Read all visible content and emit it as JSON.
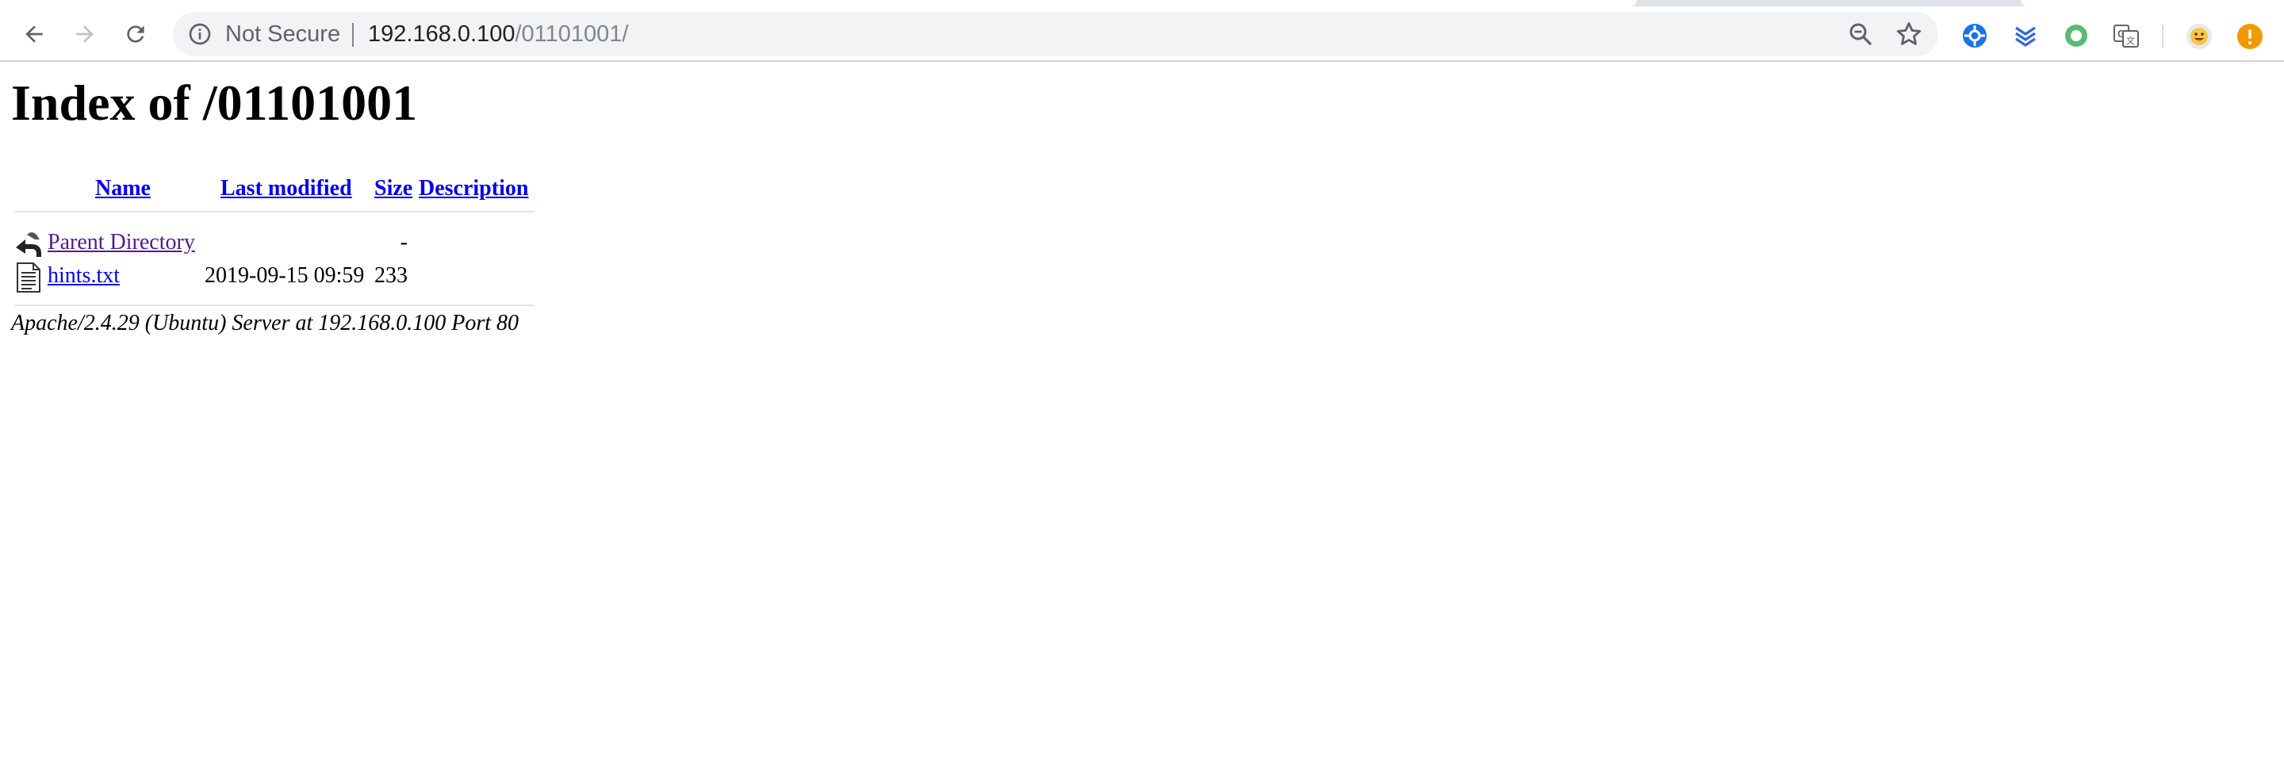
{
  "browser": {
    "security_label": "Not Secure",
    "url_host": "192.168.0.100",
    "url_path": "/01101001/",
    "nav": {
      "back_icon": "arrow-left-icon",
      "forward_icon": "arrow-right-icon",
      "reload_icon": "reload-icon"
    },
    "omnibox_icons": [
      "info-icon",
      "zoom-icon",
      "star-icon"
    ],
    "extensions": [
      "blue-extension-icon",
      "layers-extension-icon",
      "green-ring-extension-icon",
      "translate-icon",
      "avatar-icon",
      "warning-icon"
    ],
    "colors": {
      "omnibox_bg": "#f1f3f4",
      "link": "#0000ee",
      "visited_link": "#551a8b"
    }
  },
  "page": {
    "title": "Index of /01101001",
    "columns": {
      "name": "Name",
      "last_modified": "Last modified",
      "size": "Size",
      "description": "Description"
    },
    "rows": [
      {
        "icon": "back-icon",
        "name": "Parent Directory",
        "last_modified": "",
        "size": "-",
        "description": ""
      },
      {
        "icon": "text-file-icon",
        "name": "hints.txt",
        "last_modified": "2019-09-15 09:59",
        "size": "233",
        "description": ""
      }
    ],
    "footer": "Apache/2.4.29 (Ubuntu) Server at 192.168.0.100 Port 80"
  }
}
